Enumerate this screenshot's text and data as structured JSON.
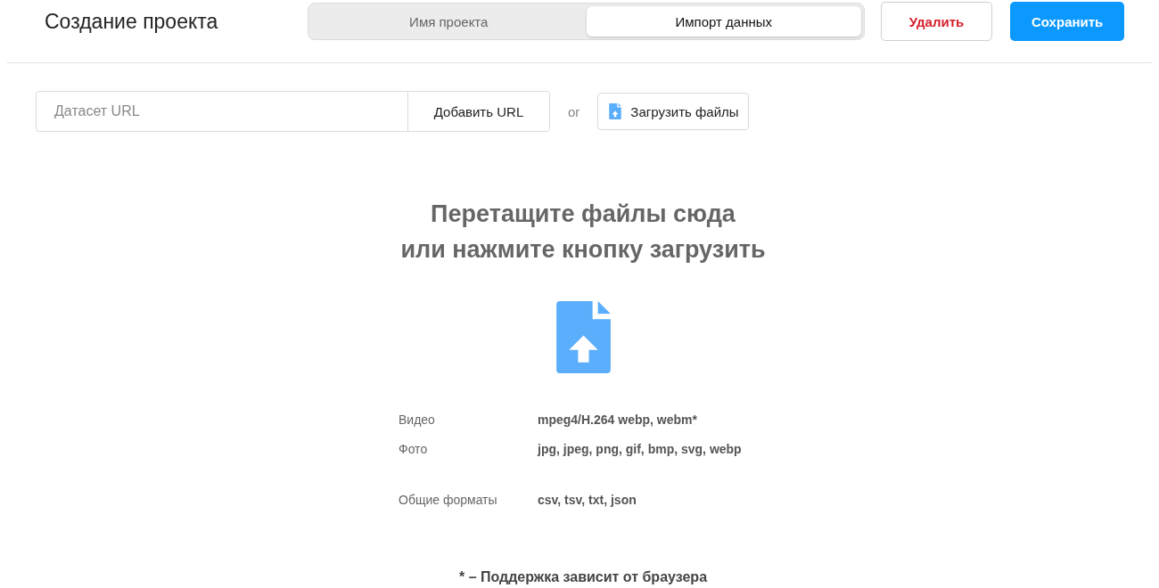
{
  "header": {
    "title": "Создание проекта",
    "tabs": [
      {
        "label": "Имя проекта",
        "selected": false
      },
      {
        "label": "Импорт данных",
        "selected": true
      }
    ],
    "buttons": [
      {
        "label": "Удалить",
        "kind": "danger"
      },
      {
        "label": "Сохранить",
        "kind": "primary"
      }
    ]
  },
  "import": {
    "url_placeholder": "Датасет URL",
    "add_button": "Добавить URL",
    "separator": "or",
    "upload_button": "Загрузить файлы"
  },
  "dropzone": {
    "heading_lines": [
      "Перетащите файлы сюда",
      "или нажмите кнопку загрузить"
    ],
    "format_groups": [
      [
        {
          "label": "Видео",
          "value": "mpeg4/H.264 webp, webm*"
        },
        {
          "label": "Фото",
          "value": "jpg, jpeg, png, gif, bmp, svg, webp"
        }
      ],
      [
        {
          "label": "Общие форматы",
          "value": "csv, tsv, txt, json"
        }
      ]
    ],
    "footnote": "* – Поддержка зависит от браузера"
  }
}
